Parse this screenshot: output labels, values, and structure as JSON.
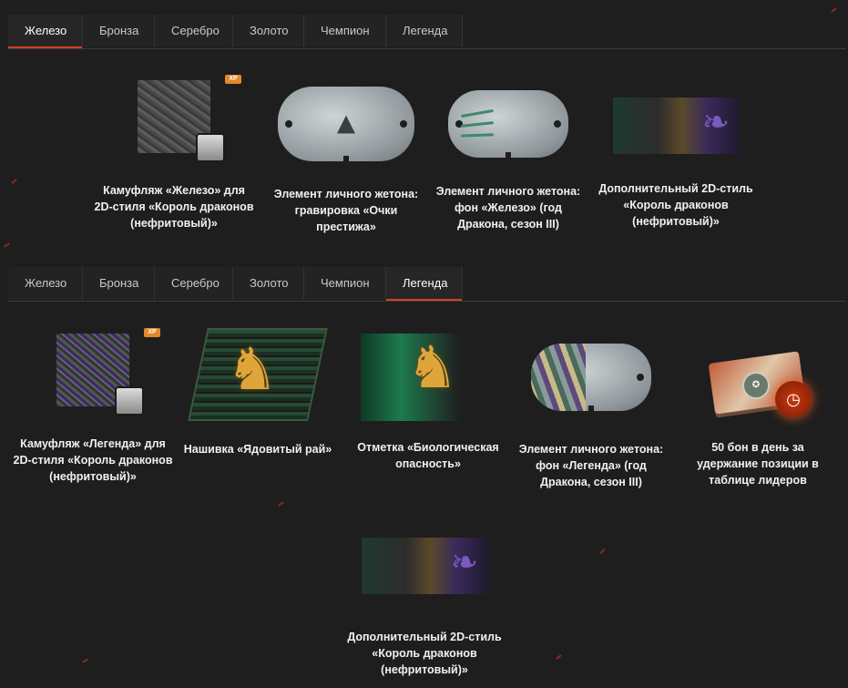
{
  "tabs_top": {
    "items": [
      "Железо",
      "Бронза",
      "Серебро",
      "Золото",
      "Чемпион",
      "Легенда"
    ],
    "active": "Железо"
  },
  "tabs_bottom": {
    "items": [
      "Железо",
      "Бронза",
      "Серебро",
      "Золото",
      "Чемпион",
      "Легенда"
    ],
    "active": "Легенда"
  },
  "section_iron": {
    "rewards": [
      {
        "icon": "camouflage-icon",
        "label": "Камуфляж «Железо» для 2D-стиля «Король драконов (нефритовый)»"
      },
      {
        "icon": "dog-tag-engraving-icon",
        "label": "Элемент личного жетона: гравировка «Очки престижа»"
      },
      {
        "icon": "dog-tag-background-icon",
        "label": "Элемент личного жетона: фон «Железо» (год Дракона, сезон III)"
      },
      {
        "icon": "2d-style-icon",
        "label": "Дополнительный 2D-стиль «Король драконов (нефритовый)»"
      }
    ]
  },
  "section_legend": {
    "rewards": [
      {
        "icon": "camouflage-icon",
        "label": "Камуфляж «Легенда» для 2D-стиля «Король драконов (нефритовый)»"
      },
      {
        "icon": "patch-dragon-icon",
        "label": "Нашивка «Ядовитый рай»"
      },
      {
        "icon": "mark-dragon-icon",
        "label": "Отметка «Биологическая опасность»"
      },
      {
        "icon": "dog-tag-background-icon",
        "label": "Элемент личного жетона: фон «Легенда» (год Дракона, сезон III)"
      },
      {
        "icon": "bonds-timer-icon",
        "label": "50 бон в день за удержание позиции в таблице лидеров"
      },
      {
        "icon": "2d-style-icon",
        "label": "Дополнительный 2D-стиль «Король драконов (нефритовый)»"
      }
    ]
  },
  "colors": {
    "background": "#1e1e1e",
    "accent_underline": "#d1421c",
    "tab_text": "#c9c9c9"
  }
}
